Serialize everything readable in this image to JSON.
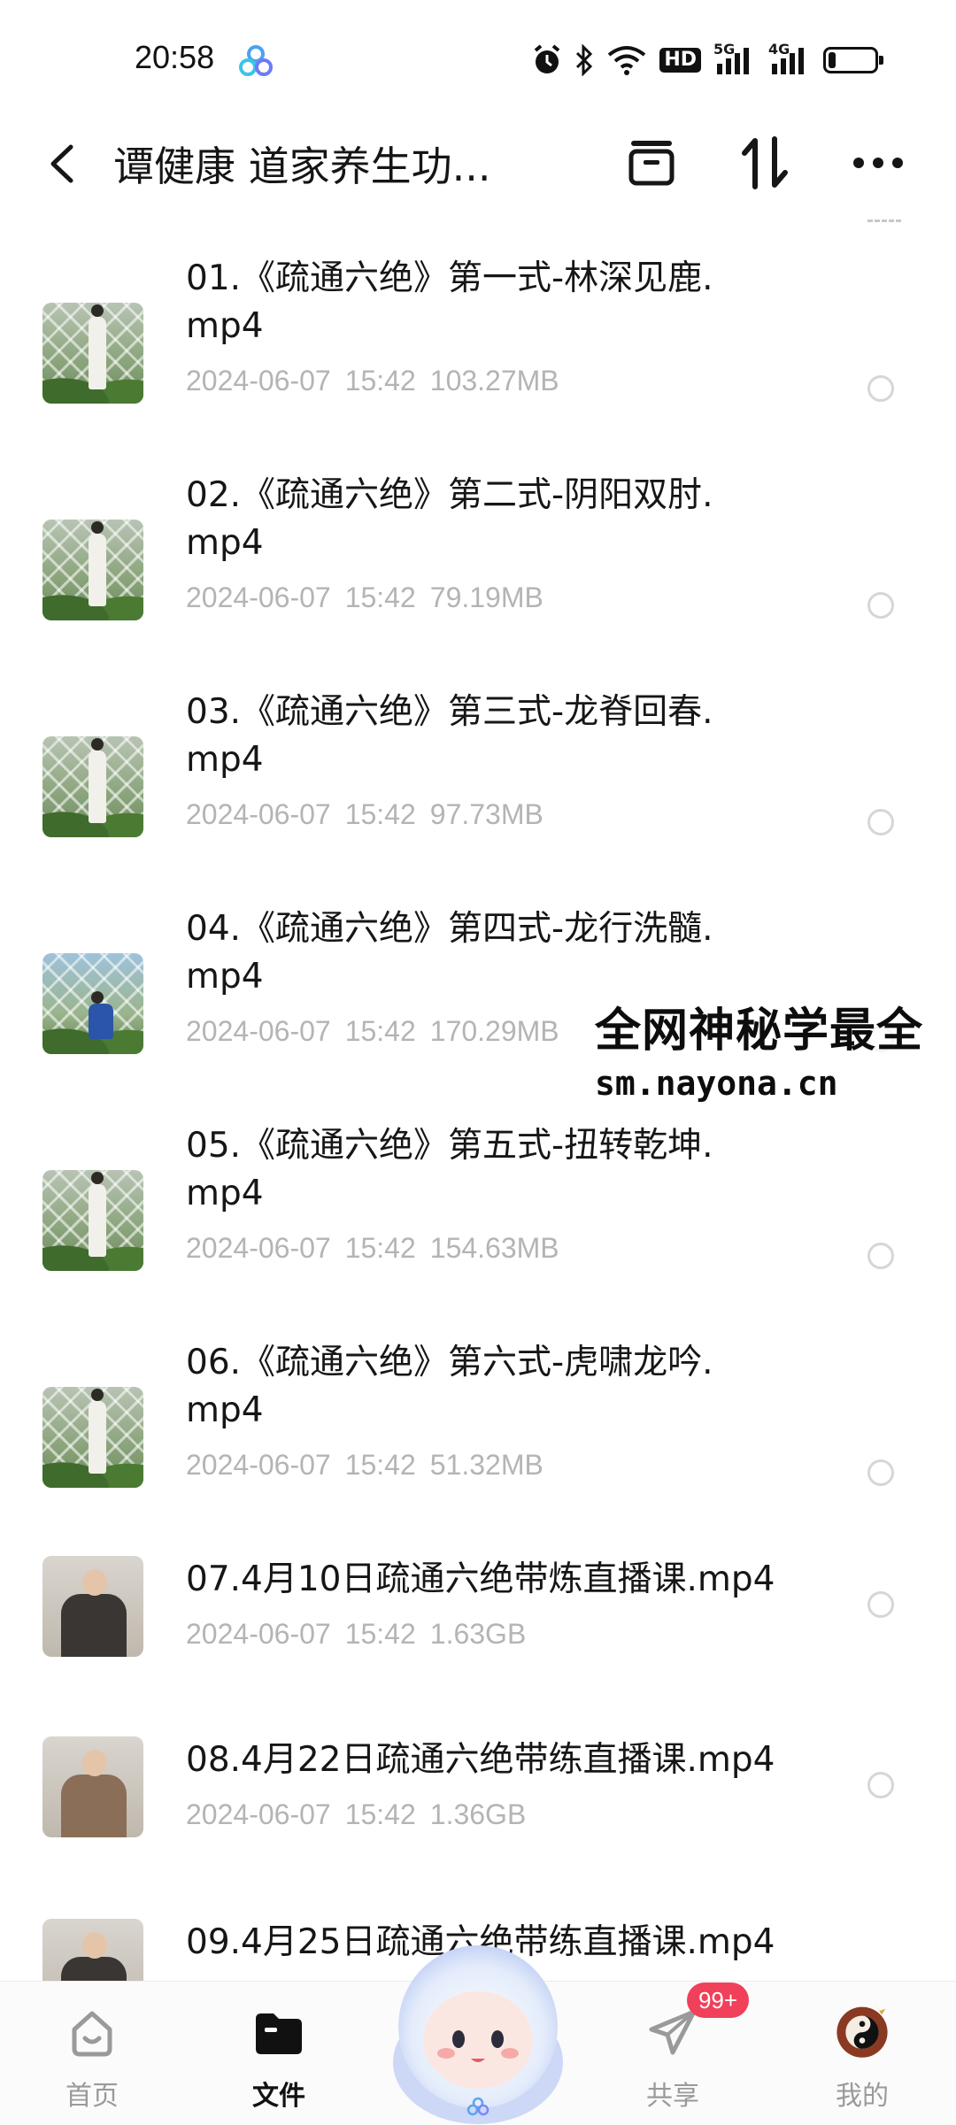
{
  "status_bar": {
    "time": "20:58",
    "icons": [
      "alarm-icon",
      "bluetooth-icon",
      "wifi-icon",
      "hd-icon",
      "signal-5g-icon",
      "signal-4g-icon",
      "battery-icon"
    ],
    "hd_label": "HD",
    "sig1_label": "5G",
    "sig2_label": "4G",
    "battery_level": 0.15
  },
  "header": {
    "title": "谭健康 道家养生功...",
    "actions": [
      "archive-icon",
      "sort-icon",
      "more-icon"
    ]
  },
  "files": [
    {
      "name": "01.《疏通六绝》第一式-林深见鹿.mp4",
      "date": "2024-06-07",
      "time": "15:42",
      "size": "103.27MB"
    },
    {
      "name": "02.《疏通六绝》第二式-阴阳双肘.mp4",
      "date": "2024-06-07",
      "time": "15:42",
      "size": "79.19MB"
    },
    {
      "name": "03.《疏通六绝》第三式-龙脊回春.mp4",
      "date": "2024-06-07",
      "time": "15:42",
      "size": "97.73MB"
    },
    {
      "name": "04.《疏通六绝》第四式-龙行洗髓.mp4",
      "date": "2024-06-07",
      "time": "15:42",
      "size": "170.29MB"
    },
    {
      "name": "05.《疏通六绝》第五式-扭转乾坤.mp4",
      "date": "2024-06-07",
      "time": "15:42",
      "size": "154.63MB"
    },
    {
      "name": "06.《疏通六绝》第六式-虎啸龙吟.mp4",
      "date": "2024-06-07",
      "time": "15:42",
      "size": "51.32MB"
    },
    {
      "name": "07.4月10日疏通六绝带炼直播课.mp4",
      "date": "2024-06-07",
      "time": "15:42",
      "size": "1.63GB"
    },
    {
      "name": "08.4月22日疏通六绝带练直播课.mp4",
      "date": "2024-06-07",
      "time": "15:42",
      "size": "1.36GB"
    },
    {
      "name": "09.4月25日疏通六绝带练直播课.mp4",
      "date": "",
      "time": "",
      "size": ""
    }
  ],
  "watermark": {
    "line1": "全网神秘学最全",
    "line2": "sm.nayona.cn"
  },
  "bottom_nav": {
    "items": [
      {
        "label": "首页",
        "icon": "home-icon"
      },
      {
        "label": "文件",
        "icon": "folder-icon"
      },
      {
        "label": "共享",
        "icon": "send-icon"
      },
      {
        "label": "我的",
        "icon": "avatar-icon"
      }
    ],
    "active": "文件",
    "share_badge": "99+"
  },
  "colors": {
    "badge": "#f0405a",
    "meta_text": "#b4b4b4",
    "primary_text": "#161616"
  }
}
